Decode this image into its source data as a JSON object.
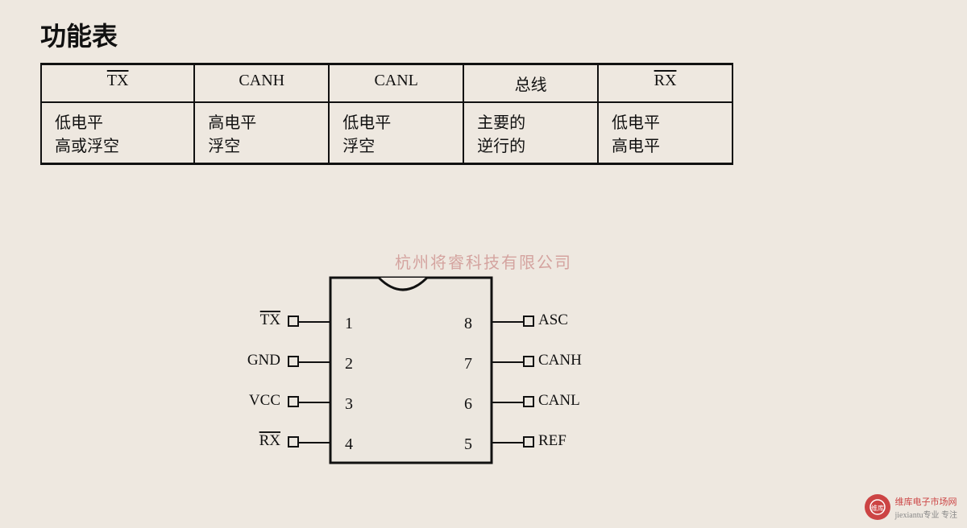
{
  "title": "功能表",
  "watermark": "杭州将睿科技有限公司",
  "table": {
    "headers": [
      "TX̄",
      "CANH",
      "CANL",
      "总线",
      "R̄X"
    ],
    "rows": [
      [
        "低电平\n高或浮空",
        "高电平\n浮空",
        "低电平\n浮空",
        "主要的\n逆行的",
        "低电平\n高电平"
      ]
    ]
  },
  "ic": {
    "pins_left": [
      {
        "num": "1",
        "label": "T̄X"
      },
      {
        "num": "2",
        "label": "GND"
      },
      {
        "num": "3",
        "label": "VCC"
      },
      {
        "num": "4",
        "label": "R̄X"
      }
    ],
    "pins_right": [
      {
        "num": "8",
        "label": "ASC"
      },
      {
        "num": "7",
        "label": "CANH"
      },
      {
        "num": "6",
        "label": "CANL"
      },
      {
        "num": "5",
        "label": "REF"
      }
    ]
  },
  "logo": {
    "site": "维库电子市场网",
    "url_text": "jiexiantu专业 专注"
  }
}
